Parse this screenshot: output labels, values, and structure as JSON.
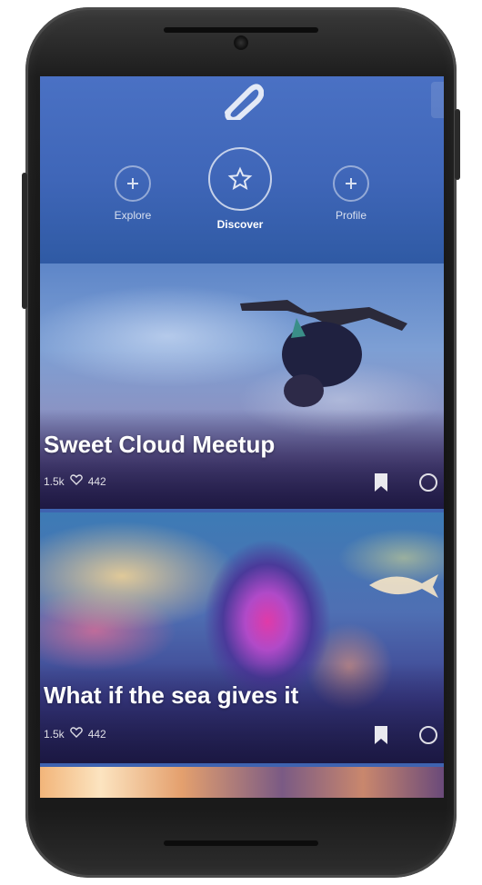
{
  "header": {
    "logo_icon": "paperclip-icon",
    "nav": [
      {
        "label": "Explore",
        "icon": "plus-icon"
      },
      {
        "label": "Discover",
        "icon": "star-icon"
      },
      {
        "label": "Profile",
        "icon": "plus-icon"
      }
    ]
  },
  "cards": [
    {
      "title": "Sweet Cloud Meetup",
      "meta": {
        "views": "1.5k",
        "likes": "442"
      },
      "actions": [
        "bookmark-icon",
        "share-icon"
      ]
    },
    {
      "title": "What if the sea gives it",
      "meta": {
        "views": "1.5k",
        "likes": "442"
      },
      "actions": [
        "bookmark-icon",
        "share-icon"
      ]
    },
    {
      "title": ""
    }
  ],
  "colors": {
    "header_bg": "#4a71c4",
    "screen_bg": "#3f63b0",
    "text_primary": "#ffffff"
  }
}
